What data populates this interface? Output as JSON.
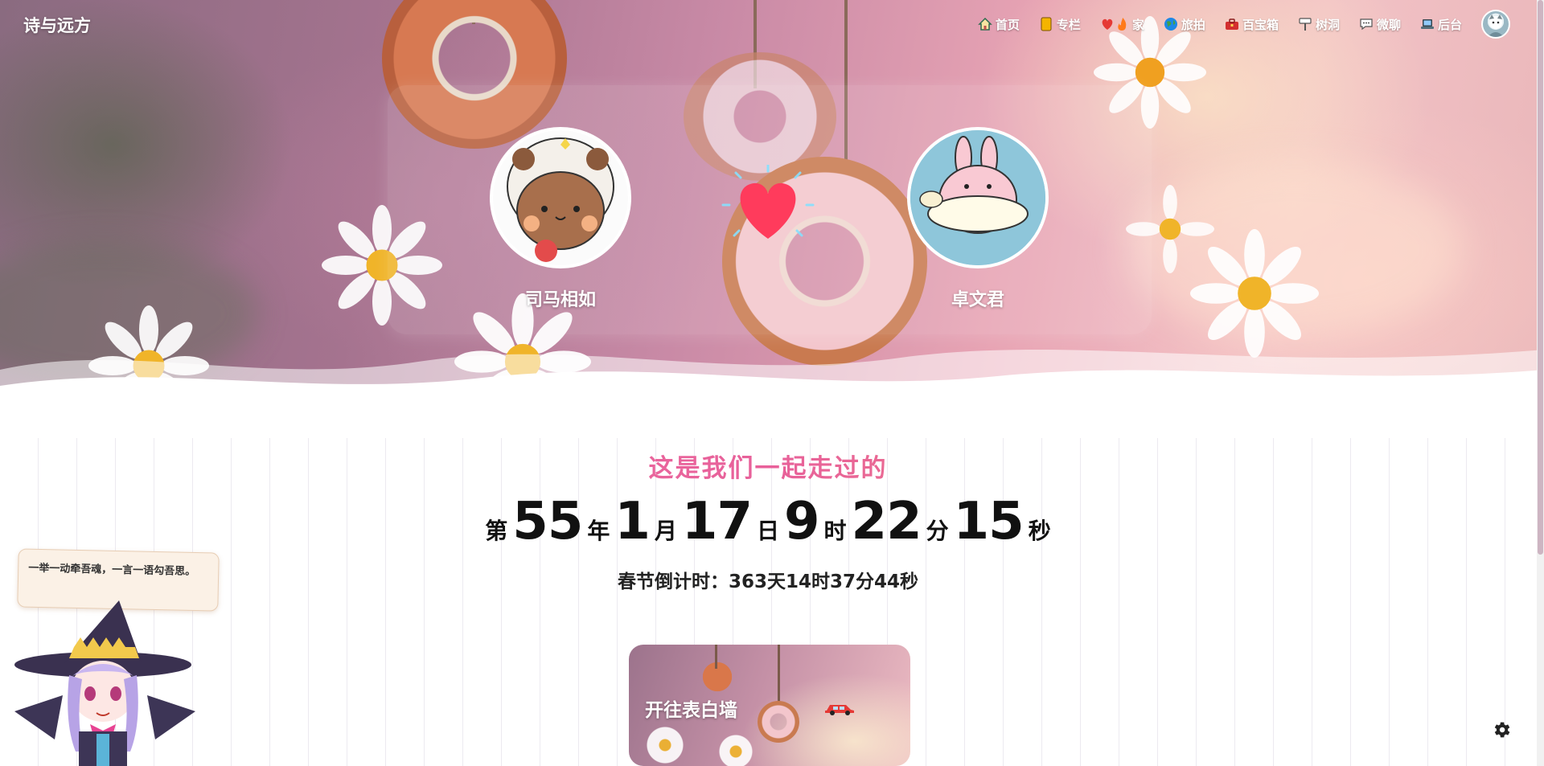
{
  "site": {
    "title": "诗与远方"
  },
  "nav": {
    "items": [
      {
        "label": "首页",
        "icon": "house-icon"
      },
      {
        "label": "专栏",
        "icon": "notebook-icon"
      },
      {
        "label": "家",
        "icon": "heart-fire-icon"
      },
      {
        "label": "旅拍",
        "icon": "globe-icon"
      },
      {
        "label": "百宝箱",
        "icon": "toolbox-icon"
      },
      {
        "label": "树洞",
        "icon": "signpost-icon"
      },
      {
        "label": "微聊",
        "icon": "chat-bubble-icon"
      },
      {
        "label": "后台",
        "icon": "laptop-icon"
      }
    ],
    "avatar_icon": "user-avatar-icon"
  },
  "couple": {
    "left_name": "司马相如",
    "right_name": "卓文君",
    "center_icon": "heart-icon",
    "heart_color": "#ff3b5c"
  },
  "love": {
    "title": "这是我们一起走过的",
    "prefix": "第",
    "years": "55",
    "years_unit": "年",
    "months": "1",
    "months_unit": "月",
    "days": "17",
    "days_unit": "日",
    "hours": "9",
    "hours_unit": "时",
    "minutes": "22",
    "minutes_unit": "分",
    "seconds": "15",
    "seconds_unit": "秒",
    "countdown": "春节倒计时：363天14时37分44秒"
  },
  "wall_card": {
    "label": "开往表白墙",
    "icon": "car-icon"
  },
  "mascot": {
    "quote": "一举一动牵吾魂，一言一语勾吾思。"
  },
  "settings": {
    "icon": "gear-icon"
  },
  "colors": {
    "title_gradient_start": "#f07ea6",
    "title_gradient_end": "#f29c74",
    "accent": "#ff3b5c"
  }
}
